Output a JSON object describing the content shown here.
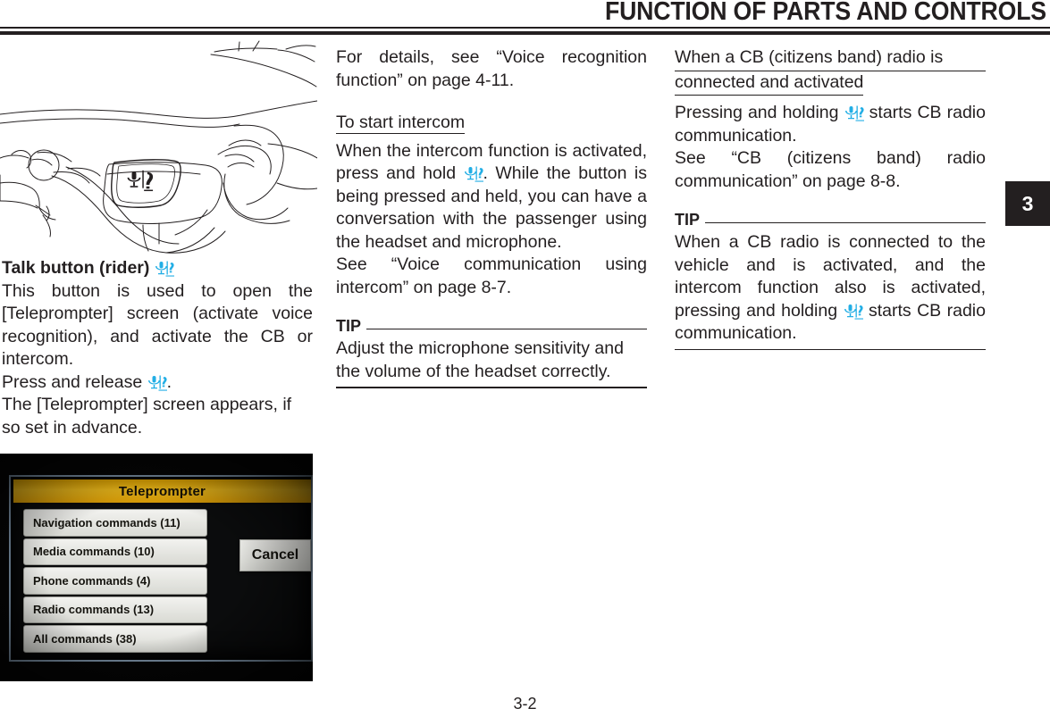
{
  "header": {
    "title": "FUNCTION OF PARTS AND CONTROLS"
  },
  "chapter_tab": {
    "number": "3"
  },
  "icons": {
    "talk_button_icon": "microphone-headset-icon"
  },
  "colors": {
    "icon_blue": "#22AEE5",
    "text": "#231F20",
    "tip_rule": "#231F20",
    "tab_background": "#231F20",
    "tab_text": "#FFFFFF",
    "photo_titlebar": "#E0A400",
    "photo_bezel": "#7D93A8"
  },
  "illustration": {
    "caption_name": "handlebar-talk-button-illustration"
  },
  "left_column": {
    "heading": "Talk button (rider)",
    "paragraphs": [
      "This button is used to open the [Teleprompter] screen (activate voice recognition), and activate the CB or intercom.",
      "Press and release",
      "The [Teleprompter] screen appears, if so set in advance."
    ],
    "press_release_prefix": "Press and release ",
    "press_release_suffix": "."
  },
  "middle_column": {
    "intro": "For details, see “Voice recognition function” on page 4-11.",
    "subheading": "To start intercom",
    "para_1_before_icon": "When the intercom function is activated, press and hold ",
    "para_1_after_icon": ". While the button is being pressed and held, you can have a conversation with the passenger using the headset and microphone.",
    "para_2": "See “Voice communication using intercom” on page 8-7.",
    "tip": {
      "label": "TIP",
      "body": "Adjust the microphone sensitivity and the volume of the headset correctly."
    }
  },
  "right_column": {
    "subheading_line_1": "When a CB (citizens band) radio is",
    "subheading_line_2": "connected and activated",
    "para_1_before_icon": "Pressing and holding ",
    "para_1_after_icon": " starts CB radio communication.",
    "para_2": "See “CB (citizens band) radio communication” on page 8-8.",
    "tip": {
      "label": "TIP",
      "body_before_icon": "When a CB radio is connected to the vehicle and is activated, and the intercom function also is activated, pressing and holding ",
      "body_after_icon": " starts CB radio communication."
    }
  },
  "teleprompter_photo": {
    "title": "Teleprompter",
    "items": [
      "Navigation commands (11)",
      "Media commands (10)",
      "Phone commands (4)",
      "Radio commands (13)",
      "All commands (38)"
    ],
    "cancel_label": "Cancel"
  },
  "footer": {
    "page_number": "3-2"
  }
}
